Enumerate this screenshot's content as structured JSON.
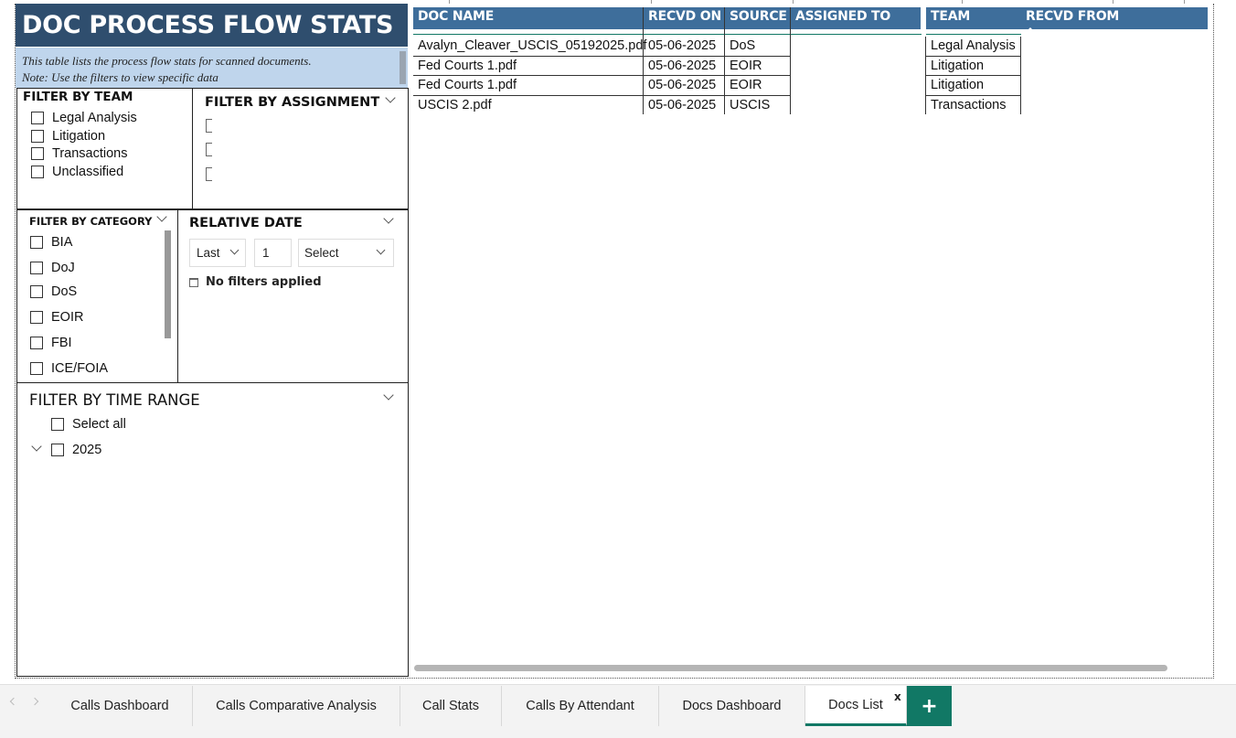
{
  "report": {
    "title": "DOC PROCESS FLOW STATS",
    "description_line1": "This table lists the process flow stats for scanned documents.",
    "description_line2": "Note:  Use the filters to view specific data"
  },
  "filter_team": {
    "header": "FILTER BY TEAM",
    "options": [
      "Legal Analysis",
      "Litigation",
      "Transactions",
      "Unclassified"
    ]
  },
  "filter_assignment": {
    "header": "FILTER BY ASSIGNMENT"
  },
  "filter_category": {
    "header": "FILTER BY CATEGORY",
    "options": [
      "BIA",
      "DoJ",
      "DoS",
      "EOIR",
      "FBI",
      "ICE/FOIA"
    ]
  },
  "relative_date": {
    "header": "RELATIVE DATE",
    "period": "Last",
    "count": "1",
    "unit": "Select",
    "status": "No filters applied"
  },
  "filter_time": {
    "header": "FILTER BY TIME RANGE",
    "select_all": "Select all",
    "year": "2025"
  },
  "table": {
    "columns": [
      "DOC NAME",
      "RECVD ON",
      "SOURCE",
      "ASSIGNED TO",
      "TEAM",
      "RECVD FROM"
    ],
    "rows": [
      [
        "Avalyn_Cleaver_USCIS_05192025.pdf",
        "05-06-2025",
        "DoS",
        "",
        "Legal Analysis",
        ""
      ],
      [
        "Fed Courts 1.pdf",
        "05-06-2025",
        "EOIR",
        "",
        "Litigation",
        ""
      ],
      [
        "Fed Courts 1.pdf",
        "05-06-2025",
        "EOIR",
        "",
        "Litigation",
        ""
      ],
      [
        "USCIS 2.pdf",
        "05-06-2025",
        "USCIS",
        "",
        "Transactions",
        ""
      ]
    ]
  },
  "tabs": [
    "Calls Dashboard",
    "Calls Comparative Analysis",
    "Call Stats",
    "Calls By Attendant",
    "Docs Dashboard",
    "Docs List"
  ],
  "active_tab": "Docs List",
  "tab_close": "x",
  "add_tab": "+",
  "colors": {
    "title_bg": "#2f4e6e",
    "desc_bg": "#bfd5ec",
    "header_bg": "#3e6e9b",
    "accent": "#117865"
  }
}
